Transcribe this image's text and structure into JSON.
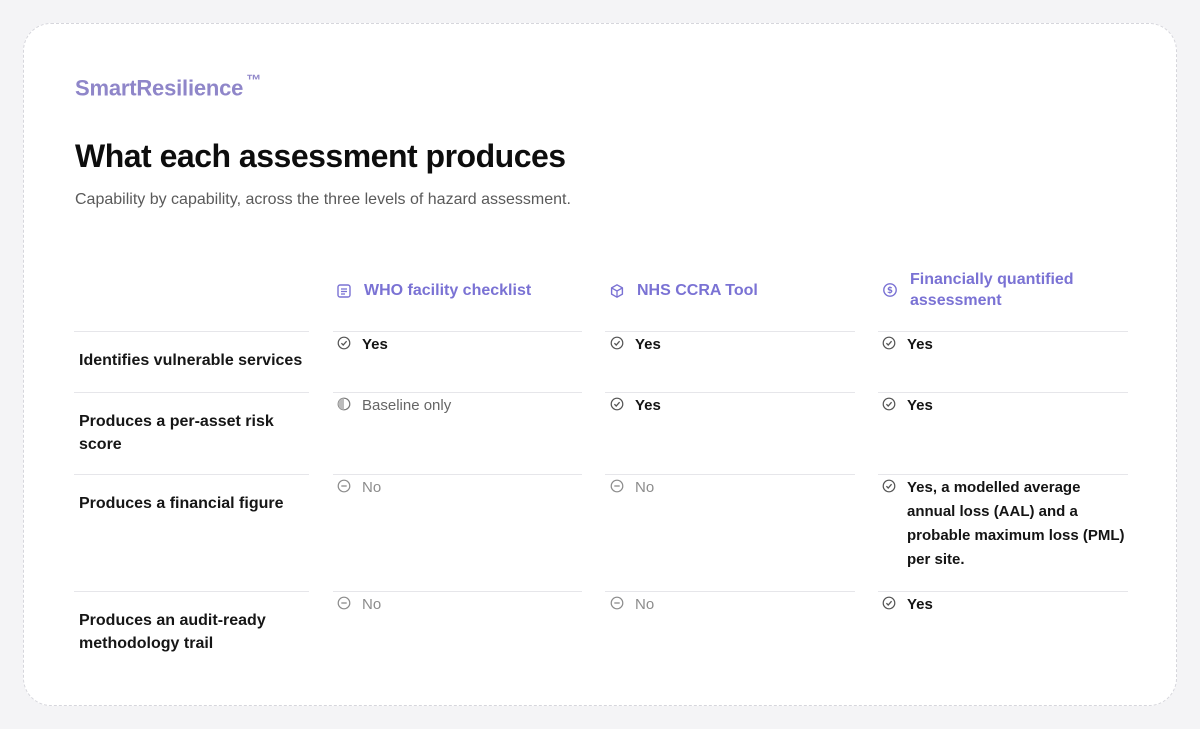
{
  "brand": {
    "name": "SmartResilience",
    "mark": "TM"
  },
  "title": "What each assessment produces",
  "subtitle": "Capability by capability, across the three levels of hazard assessment.",
  "columns": [
    {
      "label": "WHO facility checklist",
      "icon": "list-icon"
    },
    {
      "label": "NHS CCRA Tool",
      "icon": "globe-icon"
    },
    {
      "label": "Financially quantified assessment",
      "icon": "dollar-icon"
    }
  ],
  "rows": [
    {
      "label": "Identifies vulnerable services",
      "cells": [
        {
          "status": "yes",
          "text": "Yes"
        },
        {
          "status": "yes",
          "text": "Yes"
        },
        {
          "status": "yes",
          "text": "Yes"
        }
      ]
    },
    {
      "label": "Produces a per-asset risk score",
      "cells": [
        {
          "status": "partial",
          "text": "Baseline only"
        },
        {
          "status": "yes",
          "text": "Yes"
        },
        {
          "status": "yes",
          "text": "Yes"
        }
      ]
    },
    {
      "label": "Produces a financial figure",
      "cells": [
        {
          "status": "no",
          "text": "No"
        },
        {
          "status": "no",
          "text": "No"
        },
        {
          "status": "yes",
          "text": "Yes, a modelled average annual loss (AAL) and a probable maximum loss (PML) per site."
        }
      ]
    },
    {
      "label": "Produces an audit-ready methodology trail",
      "cells": [
        {
          "status": "no",
          "text": "No"
        },
        {
          "status": "no",
          "text": "No"
        },
        {
          "status": "yes",
          "text": "Yes"
        }
      ]
    }
  ],
  "colors": {
    "accent": "#7a72d4",
    "brand": "#8f86c9",
    "yes": "#141414",
    "no": "#8c8c8c"
  }
}
